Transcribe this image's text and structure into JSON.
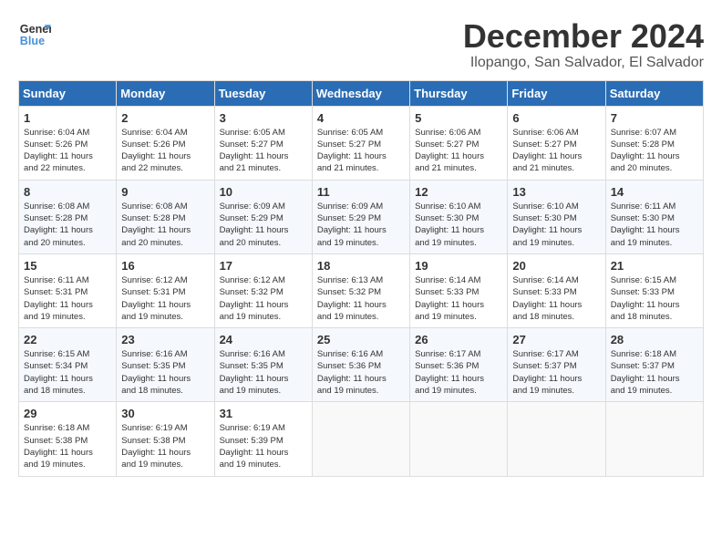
{
  "logo": {
    "line1": "General",
    "line2": "Blue"
  },
  "title": "December 2024",
  "location": "Ilopango, San Salvador, El Salvador",
  "days_of_week": [
    "Sunday",
    "Monday",
    "Tuesday",
    "Wednesday",
    "Thursday",
    "Friday",
    "Saturday"
  ],
  "weeks": [
    [
      {
        "day": "1",
        "info": "Sunrise: 6:04 AM\nSunset: 5:26 PM\nDaylight: 11 hours\nand 22 minutes."
      },
      {
        "day": "2",
        "info": "Sunrise: 6:04 AM\nSunset: 5:26 PM\nDaylight: 11 hours\nand 22 minutes."
      },
      {
        "day": "3",
        "info": "Sunrise: 6:05 AM\nSunset: 5:27 PM\nDaylight: 11 hours\nand 21 minutes."
      },
      {
        "day": "4",
        "info": "Sunrise: 6:05 AM\nSunset: 5:27 PM\nDaylight: 11 hours\nand 21 minutes."
      },
      {
        "day": "5",
        "info": "Sunrise: 6:06 AM\nSunset: 5:27 PM\nDaylight: 11 hours\nand 21 minutes."
      },
      {
        "day": "6",
        "info": "Sunrise: 6:06 AM\nSunset: 5:27 PM\nDaylight: 11 hours\nand 21 minutes."
      },
      {
        "day": "7",
        "info": "Sunrise: 6:07 AM\nSunset: 5:28 PM\nDaylight: 11 hours\nand 20 minutes."
      }
    ],
    [
      {
        "day": "8",
        "info": "Sunrise: 6:08 AM\nSunset: 5:28 PM\nDaylight: 11 hours\nand 20 minutes."
      },
      {
        "day": "9",
        "info": "Sunrise: 6:08 AM\nSunset: 5:28 PM\nDaylight: 11 hours\nand 20 minutes."
      },
      {
        "day": "10",
        "info": "Sunrise: 6:09 AM\nSunset: 5:29 PM\nDaylight: 11 hours\nand 20 minutes."
      },
      {
        "day": "11",
        "info": "Sunrise: 6:09 AM\nSunset: 5:29 PM\nDaylight: 11 hours\nand 19 minutes."
      },
      {
        "day": "12",
        "info": "Sunrise: 6:10 AM\nSunset: 5:30 PM\nDaylight: 11 hours\nand 19 minutes."
      },
      {
        "day": "13",
        "info": "Sunrise: 6:10 AM\nSunset: 5:30 PM\nDaylight: 11 hours\nand 19 minutes."
      },
      {
        "day": "14",
        "info": "Sunrise: 6:11 AM\nSunset: 5:30 PM\nDaylight: 11 hours\nand 19 minutes."
      }
    ],
    [
      {
        "day": "15",
        "info": "Sunrise: 6:11 AM\nSunset: 5:31 PM\nDaylight: 11 hours\nand 19 minutes."
      },
      {
        "day": "16",
        "info": "Sunrise: 6:12 AM\nSunset: 5:31 PM\nDaylight: 11 hours\nand 19 minutes."
      },
      {
        "day": "17",
        "info": "Sunrise: 6:12 AM\nSunset: 5:32 PM\nDaylight: 11 hours\nand 19 minutes."
      },
      {
        "day": "18",
        "info": "Sunrise: 6:13 AM\nSunset: 5:32 PM\nDaylight: 11 hours\nand 19 minutes."
      },
      {
        "day": "19",
        "info": "Sunrise: 6:14 AM\nSunset: 5:33 PM\nDaylight: 11 hours\nand 19 minutes."
      },
      {
        "day": "20",
        "info": "Sunrise: 6:14 AM\nSunset: 5:33 PM\nDaylight: 11 hours\nand 18 minutes."
      },
      {
        "day": "21",
        "info": "Sunrise: 6:15 AM\nSunset: 5:33 PM\nDaylight: 11 hours\nand 18 minutes."
      }
    ],
    [
      {
        "day": "22",
        "info": "Sunrise: 6:15 AM\nSunset: 5:34 PM\nDaylight: 11 hours\nand 18 minutes."
      },
      {
        "day": "23",
        "info": "Sunrise: 6:16 AM\nSunset: 5:35 PM\nDaylight: 11 hours\nand 18 minutes."
      },
      {
        "day": "24",
        "info": "Sunrise: 6:16 AM\nSunset: 5:35 PM\nDaylight: 11 hours\nand 19 minutes."
      },
      {
        "day": "25",
        "info": "Sunrise: 6:16 AM\nSunset: 5:36 PM\nDaylight: 11 hours\nand 19 minutes."
      },
      {
        "day": "26",
        "info": "Sunrise: 6:17 AM\nSunset: 5:36 PM\nDaylight: 11 hours\nand 19 minutes."
      },
      {
        "day": "27",
        "info": "Sunrise: 6:17 AM\nSunset: 5:37 PM\nDaylight: 11 hours\nand 19 minutes."
      },
      {
        "day": "28",
        "info": "Sunrise: 6:18 AM\nSunset: 5:37 PM\nDaylight: 11 hours\nand 19 minutes."
      }
    ],
    [
      {
        "day": "29",
        "info": "Sunrise: 6:18 AM\nSunset: 5:38 PM\nDaylight: 11 hours\nand 19 minutes."
      },
      {
        "day": "30",
        "info": "Sunrise: 6:19 AM\nSunset: 5:38 PM\nDaylight: 11 hours\nand 19 minutes."
      },
      {
        "day": "31",
        "info": "Sunrise: 6:19 AM\nSunset: 5:39 PM\nDaylight: 11 hours\nand 19 minutes."
      },
      {
        "day": "",
        "info": ""
      },
      {
        "day": "",
        "info": ""
      },
      {
        "day": "",
        "info": ""
      },
      {
        "day": "",
        "info": ""
      }
    ]
  ]
}
